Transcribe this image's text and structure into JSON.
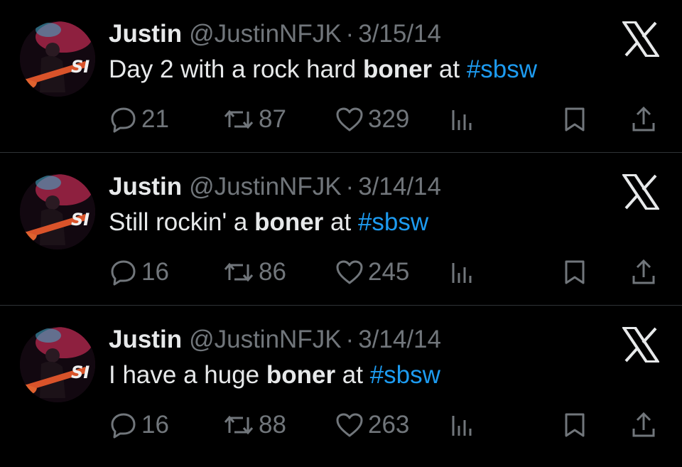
{
  "tweets": [
    {
      "name": "Justin",
      "handle": "@JustinNFJK",
      "separator": "·",
      "date": "3/15/14",
      "text_before": "Day 2 with a rock hard ",
      "text_bold": "boner",
      "text_after": " at ",
      "hashtag": "#sbsw",
      "replies": "21",
      "retweets": "87",
      "likes": "329"
    },
    {
      "name": "Justin",
      "handle": "@JustinNFJK",
      "separator": "·",
      "date": "3/14/14",
      "text_before": "Still rockin' a ",
      "text_bold": "boner",
      "text_after": " at ",
      "hashtag": "#sbsw",
      "replies": "16",
      "retweets": "86",
      "likes": "245"
    },
    {
      "name": "Justin",
      "handle": "@JustinNFJK",
      "separator": "·",
      "date": "3/14/14",
      "text_before": "I have a huge ",
      "text_bold": "boner",
      "text_after": " at ",
      "hashtag": "#sbsw",
      "replies": "16",
      "retweets": "88",
      "likes": "263"
    }
  ],
  "icons": {
    "logo": "x-logo-icon",
    "reply": "reply-icon",
    "retweet": "retweet-icon",
    "like": "heart-icon",
    "views": "views-icon",
    "bookmark": "bookmark-icon",
    "share": "share-icon"
  },
  "colors": {
    "background": "#000000",
    "text": "#e7e9ea",
    "muted": "#71767b",
    "hashtag": "#1d9bf0",
    "divider": "#2f3336"
  }
}
